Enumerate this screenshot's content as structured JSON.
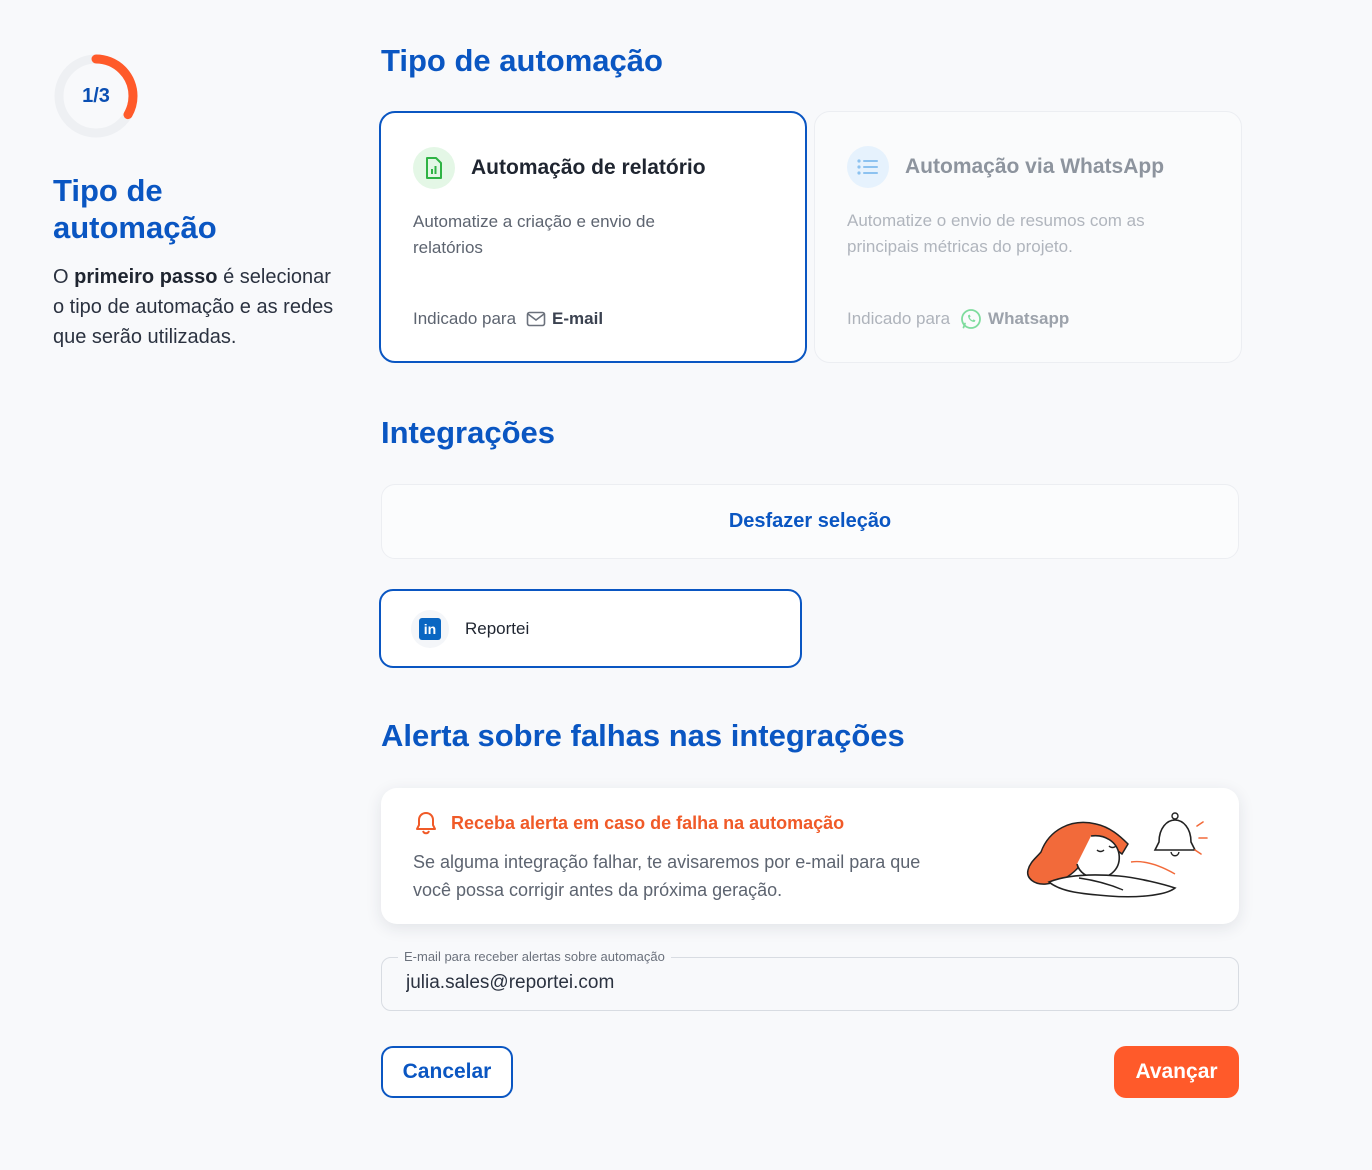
{
  "sidebar": {
    "step": "1/3",
    "progress": 0.3333,
    "title": "Tipo de automação",
    "desc_prefix": "O ",
    "desc_bold": "primeiro passo",
    "desc_suffix": " é selecionar o tipo de automação e as redes que serão utilizadas."
  },
  "automation_type": {
    "heading": "Tipo de automação",
    "cards": [
      {
        "title": "Automação de relatório",
        "description": "Automatize a criação e envio de relatórios",
        "indicated_label": "Indicado para",
        "channel": "E-mail",
        "icon": "report-chart-icon",
        "selected": true
      },
      {
        "title": "Automação via WhatsApp",
        "description": "Automatize o envio de resumos com as principais métricas do projeto.",
        "indicated_label": "Indicado para",
        "channel": "Whatsapp",
        "icon": "list-icon",
        "selected": false
      }
    ]
  },
  "integrations": {
    "heading": "Integrações",
    "undo_label": "Desfazer seleção",
    "items": [
      {
        "name": "Reportei",
        "network": "linkedin",
        "selected": true
      }
    ]
  },
  "alerts": {
    "heading": "Alerta sobre falhas nas integrações",
    "card_title": "Receba alerta em caso de falha na automação",
    "card_body": "Se alguma integração falhar, te avisaremos por e-mail para que você possa corrigir antes da próxima geração.",
    "email_label": "E-mail para receber alertas sobre automação",
    "email_value": "julia.sales@reportei.com"
  },
  "actions": {
    "cancel": "Cancelar",
    "next": "Avançar"
  },
  "colors": {
    "primary": "#0a56c2",
    "accent": "#ff5a2a",
    "whatsapp": "#25d366",
    "linkedin": "#0a66c2"
  }
}
